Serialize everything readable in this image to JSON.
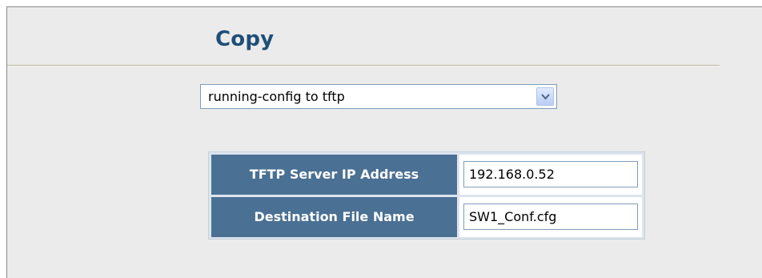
{
  "page": {
    "title": "Copy"
  },
  "copy_type": {
    "selected": "running-config to tftp"
  },
  "form": {
    "rows": [
      {
        "label": "TFTP Server IP Address",
        "value": "192.168.0.52"
      },
      {
        "label": "Destination File Name",
        "value": "SW1_Conf.cfg"
      }
    ]
  },
  "colors": {
    "title": "#1f4f78",
    "label_bg": "#4a7094",
    "panel_bg": "#ebebeb"
  }
}
